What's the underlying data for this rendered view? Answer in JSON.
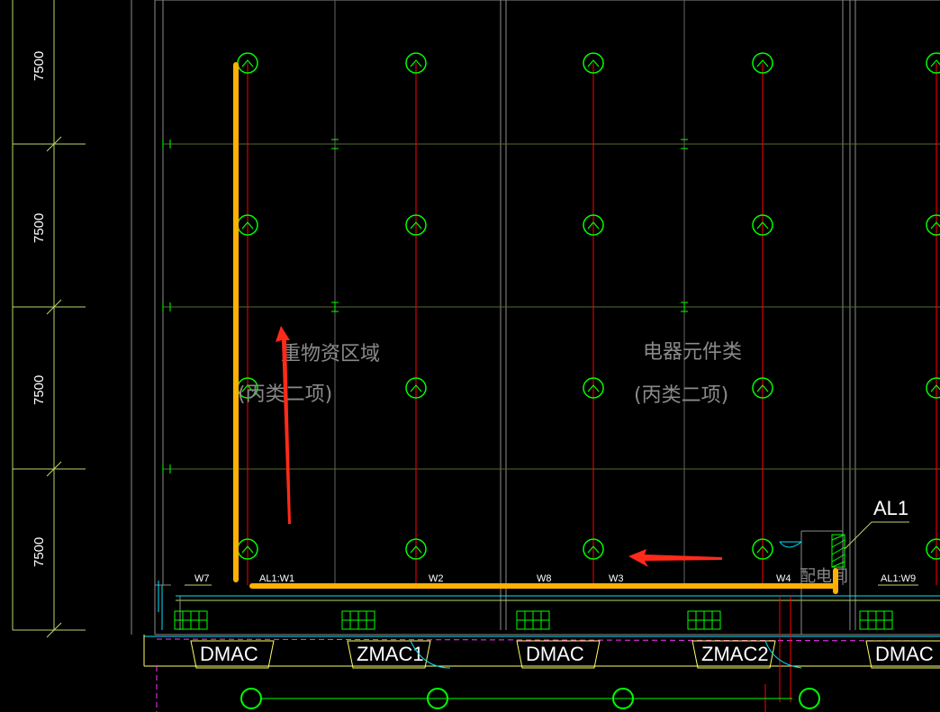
{
  "colors": {
    "background": "#000000",
    "grid_gray": "#7a7a7a",
    "dim_green": "#b9d86a",
    "light_green": "#00ff00",
    "wiring_red": "#ff0000",
    "highlight_orange": "#ffb000",
    "arrow_red": "#ff2a1a",
    "cyan": "#00e5ff",
    "magenta": "#ff33ff",
    "yellow": "#ffff66"
  },
  "dimensions": {
    "left_vertical": [
      "7500",
      "7500",
      "7500",
      "7500"
    ]
  },
  "rooms": [
    {
      "name": "重物资区域",
      "class_text": "(丙类二项)"
    },
    {
      "name": "电器元件类",
      "class_text": "(丙类二项)"
    }
  ],
  "circuit_labels": {
    "w7": "W7",
    "al1_w1": "AL1:W1",
    "w2": "W2",
    "w8": "W8",
    "w3": "W3",
    "w4": "W4",
    "room_label": "配电间",
    "al1_w9": "AL1:W9"
  },
  "panel_tag": "AL1",
  "equipment": [
    "DMAC",
    "ZMAC1",
    "DMAC",
    "ZMAC2",
    "DMAC"
  ],
  "icons": {
    "lamp": "circle-lamp-icon",
    "grille": "grille-icon",
    "arrow": "red-arrow-icon"
  }
}
